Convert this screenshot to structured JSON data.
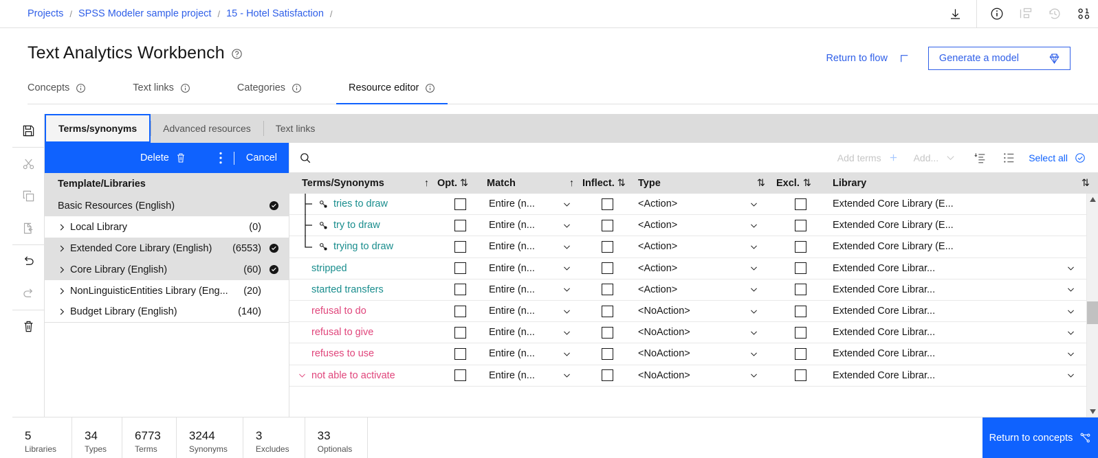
{
  "breadcrumb": {
    "items": [
      "Projects",
      "SPSS Modeler sample project",
      "15 - Hotel Satisfaction"
    ],
    "separator": "/",
    "trailing_separator": "/"
  },
  "topbar_icons": [
    "download-icon",
    "information-icon",
    "flow-icon",
    "history-icon",
    "data-icon"
  ],
  "header": {
    "title": "Text Analytics Workbench",
    "help_icon": "help-icon",
    "return_to_flow": "Return to flow",
    "return_to_flow_icon": "arrow-up-left-icon",
    "generate_model": "Generate a model",
    "generate_model_icon": "model-gem-icon"
  },
  "tabs": [
    {
      "label": "Concepts",
      "active": false
    },
    {
      "label": "Text links",
      "active": false
    },
    {
      "label": "Categories",
      "active": false
    },
    {
      "label": "Resource editor",
      "active": true
    }
  ],
  "rail": [
    {
      "name": "save-icon"
    },
    {
      "name": "cut-icon"
    },
    {
      "name": "copy-icon"
    },
    {
      "name": "paste-icon"
    },
    {
      "name": "undo-icon"
    },
    {
      "name": "redo-icon"
    },
    {
      "name": "delete-icon"
    }
  ],
  "subtabs": [
    {
      "label": "Terms/synonyms",
      "active": true
    },
    {
      "label": "Advanced resources",
      "active": false
    },
    {
      "label": "Text links",
      "active": false
    }
  ],
  "action_bar": {
    "delete_label": "Delete",
    "delete_icon": "trash-icon",
    "overflow_icon": "overflow-menu-icon",
    "cancel_label": "Cancel"
  },
  "library_panel": {
    "header": "Template/Libraries",
    "rows": [
      {
        "label": "Basic Resources (English)",
        "count": "",
        "expandable": false,
        "checked": true,
        "shaded": true
      },
      {
        "label": "Local Library",
        "count": "(0)",
        "expandable": true,
        "checked": false,
        "shaded": false
      },
      {
        "label": "Extended Core Library (English)",
        "count": "(6553)",
        "expandable": true,
        "checked": true,
        "shaded": true
      },
      {
        "label": "Core Library (English)",
        "count": "(60)",
        "expandable": true,
        "checked": true,
        "shaded": true
      },
      {
        "label": "NonLinguisticEntities Library (Eng...",
        "count": "(20)",
        "expandable": true,
        "checked": false,
        "shaded": false
      },
      {
        "label": "Budget Library (English)",
        "count": "(140)",
        "expandable": true,
        "checked": false,
        "shaded": false
      }
    ]
  },
  "table_toolbar": {
    "search_icon": "search-icon",
    "add_terms": "Add terms",
    "add_terms_icon": "add-icon",
    "add_dropdown": "Add...",
    "add_dropdown_icon": "chevron-down-icon",
    "filter_icon": "filter-sort-icon",
    "list_icon": "list-view-icon",
    "select_all": "Select all",
    "select_all_icon": "checkmark-circle-icon"
  },
  "table": {
    "columns": [
      {
        "label": "Terms/Synonyms",
        "sort": "↑"
      },
      {
        "label": "Opt.",
        "sort": "⇅"
      },
      {
        "label": "Match",
        "sort": "↑"
      },
      {
        "label": "Inflect.",
        "sort": "⇅"
      },
      {
        "label": "Type",
        "sort": "⇅"
      },
      {
        "label": "Excl.",
        "sort": "⇅"
      },
      {
        "label": "Library",
        "sort": "⇅"
      }
    ],
    "rows": [
      {
        "term": "tries to draw",
        "kind": "synonym",
        "tree": "mid",
        "opt": false,
        "match": "Entire (n...",
        "inflect": false,
        "type": "<Action>",
        "excl": false,
        "library": "Extended Core Library (E...",
        "library_dropdown": false
      },
      {
        "term": "try to draw",
        "kind": "synonym",
        "tree": "mid",
        "opt": false,
        "match": "Entire (n...",
        "inflect": false,
        "type": "<Action>",
        "excl": false,
        "library": "Extended Core Library (E...",
        "library_dropdown": false
      },
      {
        "term": "trying to draw",
        "kind": "synonym",
        "tree": "last",
        "opt": false,
        "match": "Entire (n...",
        "inflect": false,
        "type": "<Action>",
        "excl": false,
        "library": "Extended Core Library (E...",
        "library_dropdown": false
      },
      {
        "term": "stripped",
        "kind": "term",
        "tree": "none",
        "opt": false,
        "match": "Entire (n...",
        "inflect": false,
        "type": "<Action>",
        "excl": false,
        "library": "Extended Core Librar...",
        "library_dropdown": true
      },
      {
        "term": "started transfers",
        "kind": "term",
        "tree": "none",
        "opt": false,
        "match": "Entire (n...",
        "inflect": false,
        "type": "<Action>",
        "excl": false,
        "library": "Extended Core Librar...",
        "library_dropdown": true
      },
      {
        "term": "refusal to do",
        "kind": "noaction",
        "tree": "none",
        "opt": false,
        "match": "Entire (n...",
        "inflect": false,
        "type": "<NoAction>",
        "excl": false,
        "library": "Extended Core Librar...",
        "library_dropdown": true
      },
      {
        "term": "refusal to give",
        "kind": "noaction",
        "tree": "none",
        "opt": false,
        "match": "Entire (n...",
        "inflect": false,
        "type": "<NoAction>",
        "excl": false,
        "library": "Extended Core Librar...",
        "library_dropdown": true
      },
      {
        "term": "refuses to use",
        "kind": "noaction",
        "tree": "none",
        "opt": false,
        "match": "Entire (n...",
        "inflect": false,
        "type": "<NoAction>",
        "excl": false,
        "library": "Extended Core Librar...",
        "library_dropdown": true
      },
      {
        "term": "not able to activate",
        "kind": "noaction",
        "tree": "expand",
        "opt": false,
        "match": "Entire (n...",
        "inflect": false,
        "type": "<NoAction>",
        "excl": false,
        "library": "Extended Core Librar...",
        "library_dropdown": true
      }
    ]
  },
  "footer": {
    "stats": [
      {
        "value": "5",
        "label": "Libraries"
      },
      {
        "value": "34",
        "label": "Types"
      },
      {
        "value": "6773",
        "label": "Terms"
      },
      {
        "value": "3244",
        "label": "Synonyms"
      },
      {
        "value": "3",
        "label": "Excludes"
      },
      {
        "value": "33",
        "label": "Optionals"
      }
    ],
    "return_button": "Return to concepts",
    "return_button_icon": "concept-map-icon"
  },
  "colors": {
    "accent": "#0f62fe",
    "link": "#2f5fe8",
    "action": "#198d8d",
    "noaction": "#e0457b"
  }
}
